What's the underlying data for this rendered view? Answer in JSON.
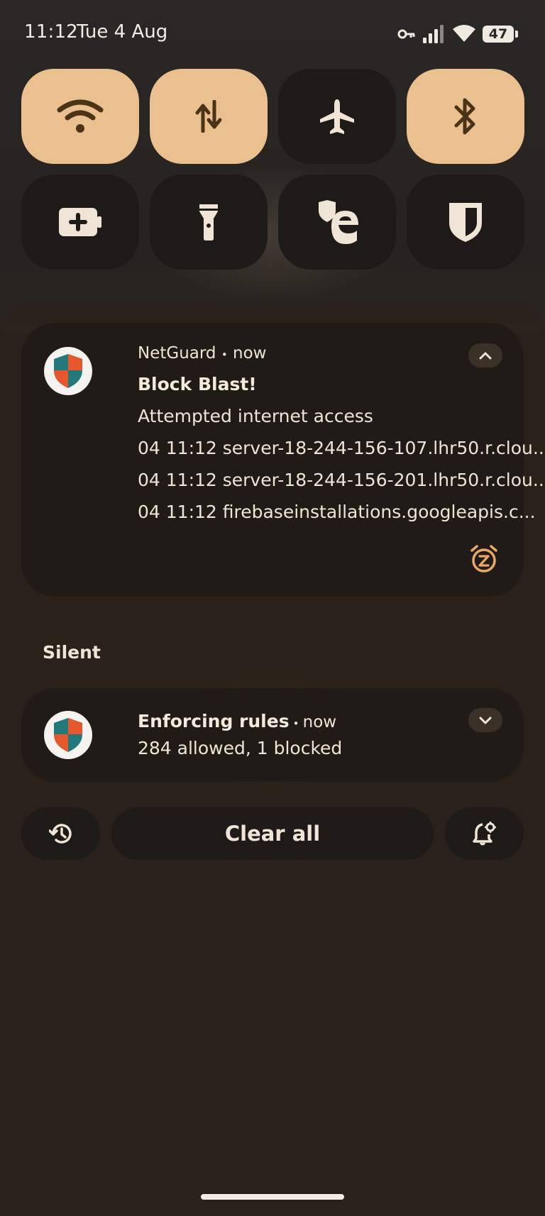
{
  "status_bar": {
    "time": "11:12",
    "date": "Tue 4 Aug",
    "battery_level": "47",
    "icons": [
      "vpn-key-icon",
      "cellular-signal-icon",
      "wifi-icon",
      "battery-icon"
    ]
  },
  "quick_settings": [
    {
      "name": "Internet",
      "icon": "wifi-icon",
      "active": true
    },
    {
      "name": "Mobile data",
      "icon": "data-transfer-icon",
      "active": true
    },
    {
      "name": "Aeroplane mode",
      "icon": "airplane-icon",
      "active": false
    },
    {
      "name": "Bluetooth",
      "icon": "bluetooth-icon",
      "active": true
    },
    {
      "name": "Battery saver",
      "icon": "battery-saver-icon",
      "active": false
    },
    {
      "name": "Torch",
      "icon": "flashlight-icon",
      "active": false
    },
    {
      "name": "Edge VPN",
      "icon": "edge-shield-icon",
      "active": false
    },
    {
      "name": "Bitwarden",
      "icon": "shield-icon",
      "active": false
    }
  ],
  "notifications": {
    "primary": {
      "app_name": "NetGuard",
      "separator": "•",
      "time": "now",
      "title": "Block Blast!",
      "subtitle": "Attempted internet access",
      "lines": [
        "04 11:12 server-18-244-156-107.lhr50.r.clou...",
        "04 11:12 server-18-244-156-201.lhr50.r.clou...",
        "04 11:12 firebaseinstallations.googleapis.c..."
      ],
      "icon": "netguard-shield-icon",
      "snooze_icon": "snooze-icon"
    },
    "silent_header": "Silent",
    "silent": {
      "title": "Enforcing rules",
      "separator": "•",
      "time": "now",
      "text": "284 allowed, 1 blocked",
      "icon": "netguard-shield-icon"
    }
  },
  "actions": {
    "history_icon": "history-icon",
    "clear_all": "Clear all",
    "settings_icon": "notification-settings-icon"
  },
  "colors": {
    "tile_active": "#ebc08f",
    "tile_inactive": "#1e1a17",
    "accent_icon": "#e8a865",
    "background": "#27201a"
  }
}
